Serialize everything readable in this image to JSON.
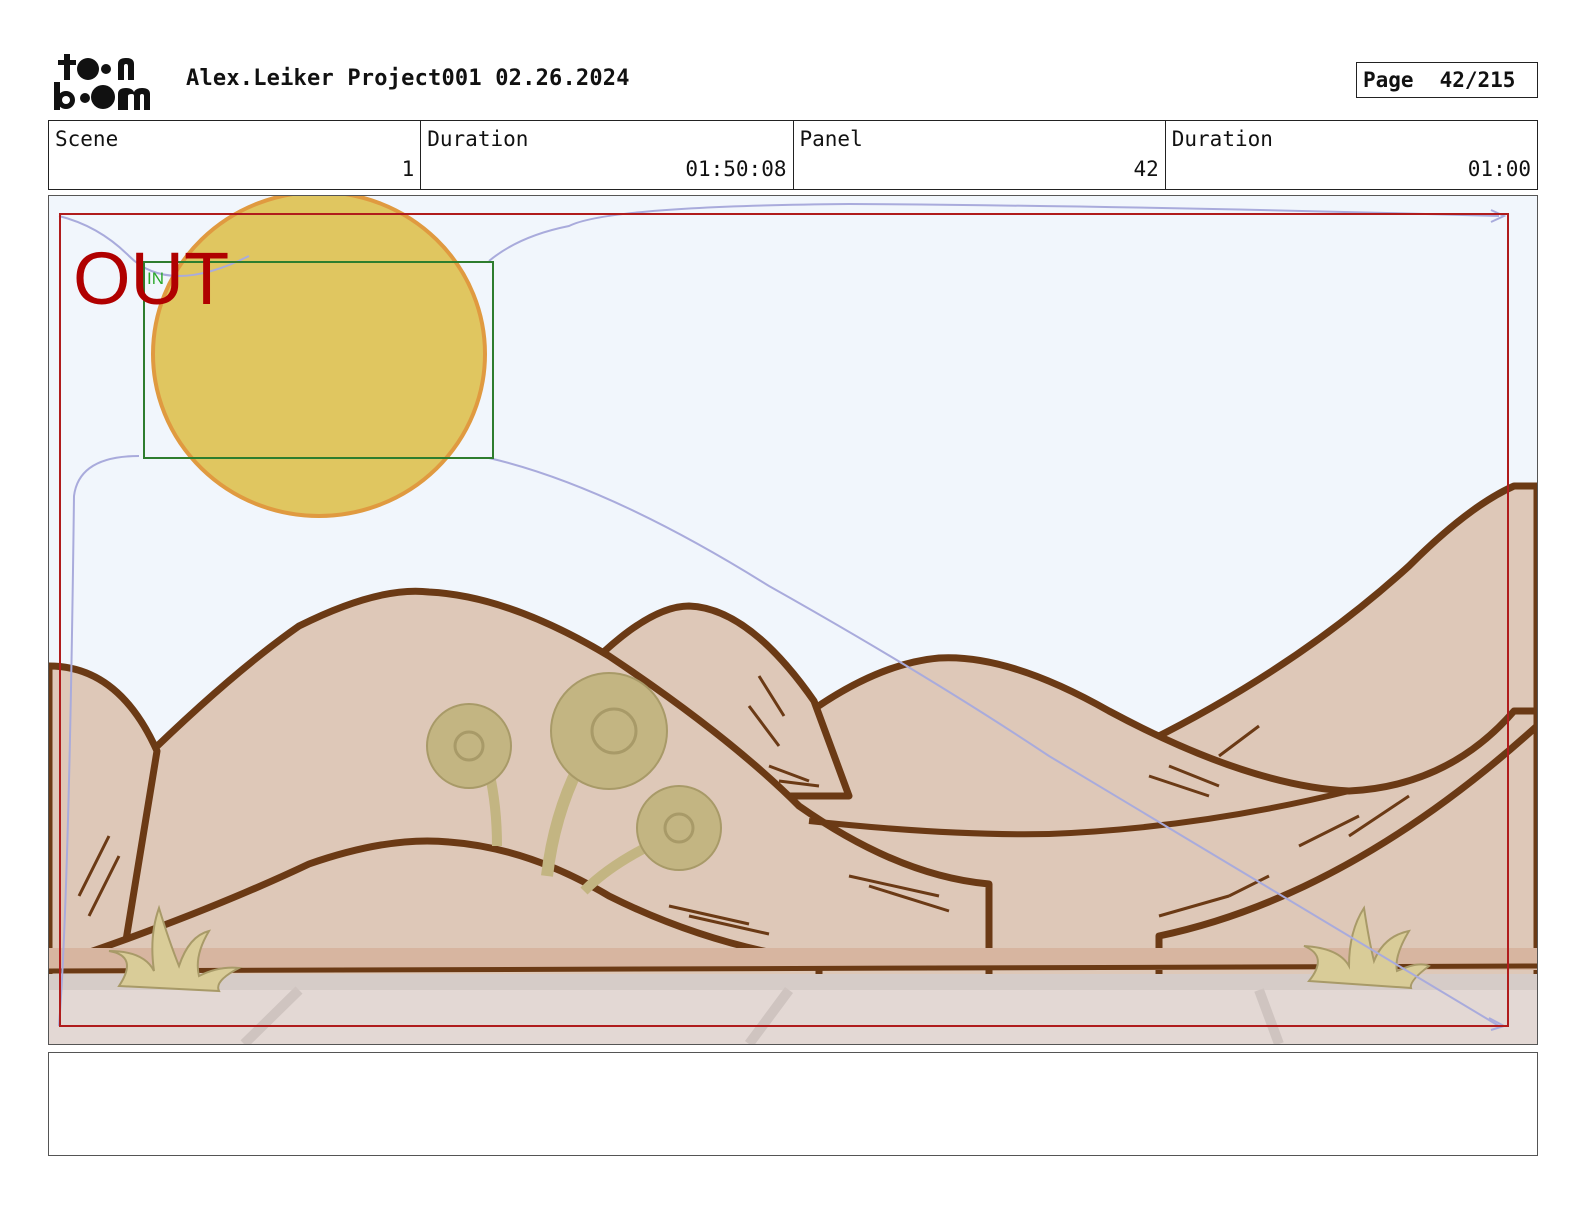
{
  "header": {
    "logo_top": "toon",
    "logo_bottom": "boom",
    "title": "Alex.Leiker Project001 02.26.2024",
    "page_label": "Page",
    "page_value": "42/215"
  },
  "info": {
    "scene_label": "Scene",
    "scene_value": "1",
    "scene_duration_label": "Duration",
    "scene_duration_value": "01:50:08",
    "panel_label": "Panel",
    "panel_value": "42",
    "panel_duration_label": "Duration",
    "panel_duration_value": "01:00"
  },
  "panel": {
    "out_label": "OUT",
    "in_label": "IN",
    "colors": {
      "sky": "#f1f6fc",
      "sun": "#e0c660",
      "sun_outline": "#e09a40",
      "hills": "#dec8b8",
      "outline": "#6b3a15",
      "trees": "#c3b582",
      "out_frame": "#b01c1c",
      "in_frame": "#2e7d2e",
      "camera_path": "#a9abdc"
    }
  },
  "notes": {
    "text": ""
  }
}
